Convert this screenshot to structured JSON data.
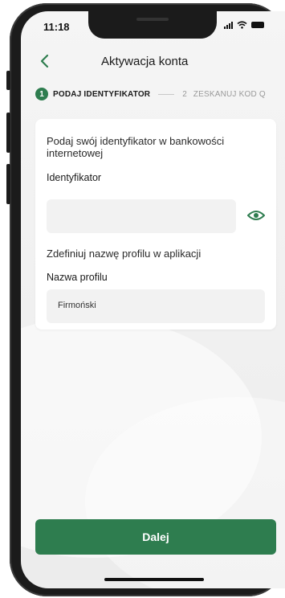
{
  "status_bar": {
    "time": "11:18"
  },
  "header": {
    "title": "Aktywacja konta",
    "back_icon": "chevron-left-icon"
  },
  "stepper": {
    "step1_number": "1",
    "step1_label": "PODAJ IDENTYFIKATOR",
    "step2_number": "2",
    "step2_label": "ZESKANUJ KOD Q"
  },
  "form": {
    "intro_text": "Podaj swój identyfikator w bankowości internetowej",
    "identifier_label": "Identyfikator",
    "identifier_value": "",
    "eye_icon": "eye-icon",
    "profile_intro": "Zdefiniuj nazwę profilu w aplikacji",
    "profile_label": "Nazwa profilu",
    "profile_value": "Firmoński"
  },
  "footer": {
    "next_label": "Dalej"
  },
  "colors": {
    "accent": "#2e7d4f",
    "background": "#efefef",
    "field": "#f2f2f2"
  }
}
